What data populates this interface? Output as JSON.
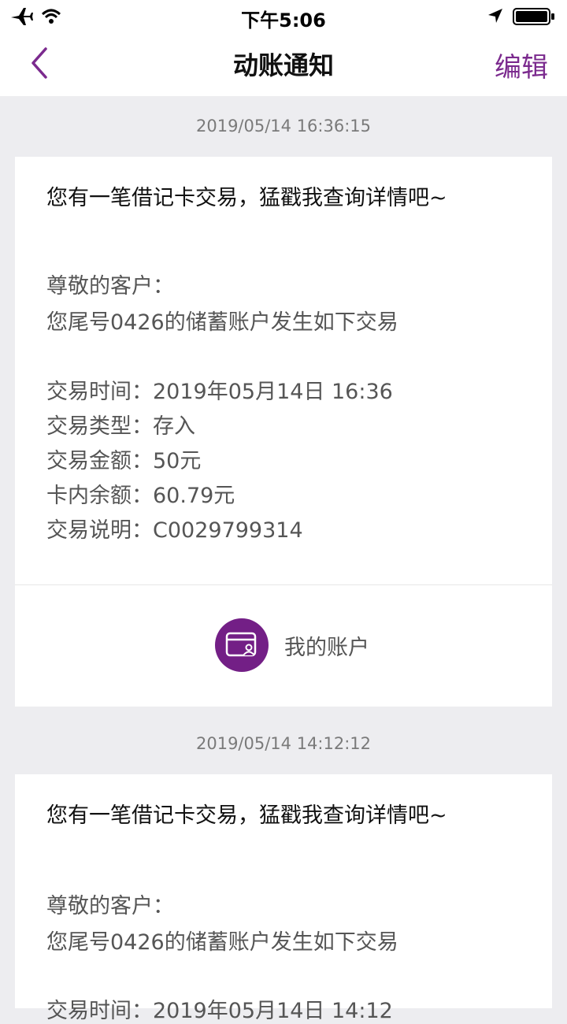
{
  "status_bar": {
    "time": "下午5:06"
  },
  "nav": {
    "title": "动账通知",
    "edit_label": "编辑"
  },
  "messages": [
    {
      "timestamp": "2019/05/14 16:36:15",
      "title": "您有一笔借记卡交易，猛戳我查询详情吧~",
      "greeting": "尊敬的客户：",
      "intro": "您尾号0426的储蓄账户发生如下交易",
      "details": [
        "交易时间：2019年05月14日  16:36",
        "交易类型：存入",
        "交易金额：50元",
        "卡内余额：60.79元",
        "交易说明：C0029799314"
      ],
      "action_label": "我的账户"
    },
    {
      "timestamp": "2019/05/14 14:12:12",
      "title": "您有一笔借记卡交易，猛戳我查询详情吧~",
      "greeting": "尊敬的客户：",
      "intro": "您尾号0426的储蓄账户发生如下交易",
      "details": [
        "交易时间：2019年05月14日  14:12"
      ]
    }
  ],
  "colors": {
    "accent": "#731f86",
    "edit": "#7b2a8e",
    "background": "#ededf0"
  },
  "icons": [
    "airplane-icon",
    "wifi-icon",
    "location-arrow-icon",
    "battery-icon",
    "back-chevron-icon",
    "account-card-icon"
  ]
}
